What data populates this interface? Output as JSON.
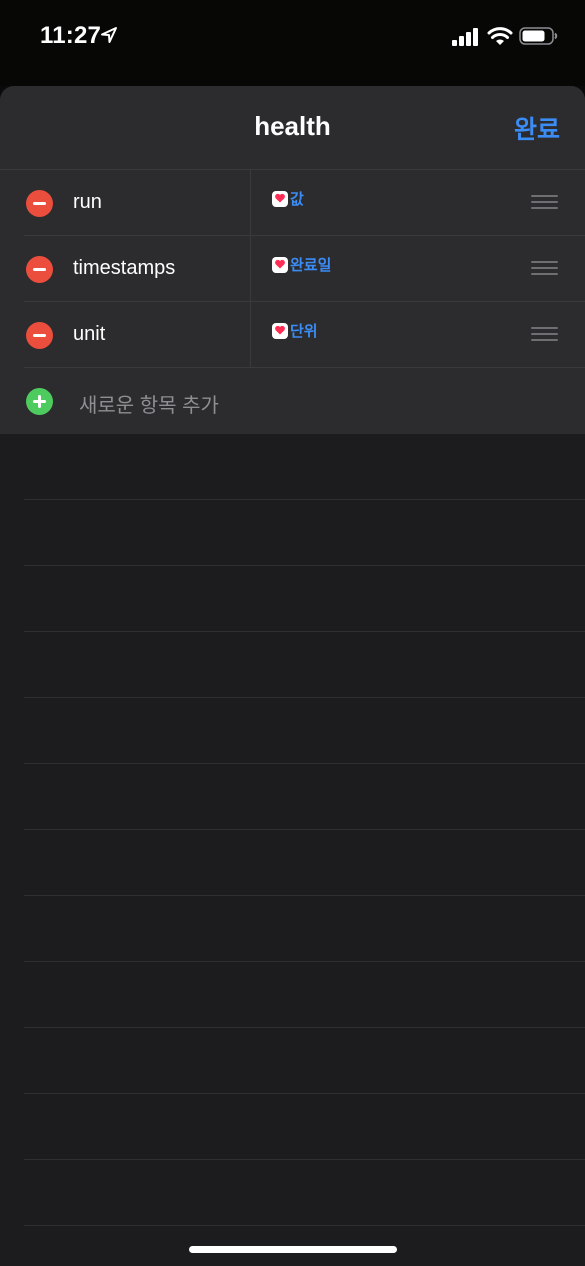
{
  "status_bar": {
    "time": "11:27",
    "icons": [
      "location-arrow-icon",
      "cellular-signal-icon",
      "wifi-icon",
      "battery-icon"
    ]
  },
  "header": {
    "title": "health",
    "done_label": "완료"
  },
  "items": [
    {
      "name": "run",
      "field": "값"
    },
    {
      "name": "timestamps",
      "field": "완료일"
    },
    {
      "name": "unit",
      "field": "단위"
    }
  ],
  "add_row": {
    "label": "새로운 항목 추가"
  },
  "colors": {
    "accent": "#3b8cf5",
    "delete": "#eb4e3d",
    "add": "#4ecb5e",
    "heart": "#ff2d55"
  }
}
